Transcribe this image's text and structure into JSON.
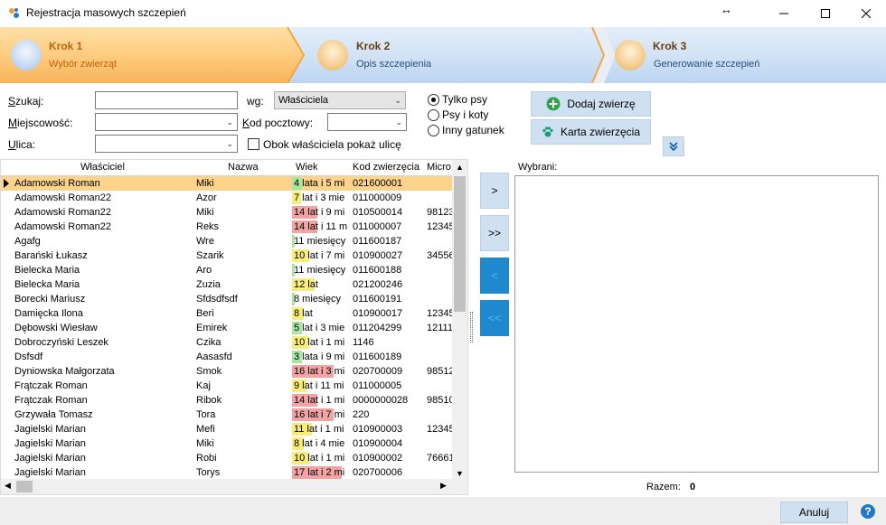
{
  "window": {
    "title": "Rejestracja masowych szczepień",
    "resize_glyph": "↔"
  },
  "wizard": {
    "steps": [
      {
        "title": "Krok 1",
        "subtitle": "Wybór zwierząt"
      },
      {
        "title": "Krok 2",
        "subtitle": "Opis szczepienia"
      },
      {
        "title": "Krok 3",
        "subtitle": "Generowanie szczepień"
      }
    ]
  },
  "filters": {
    "search_label": "Szukaj:",
    "search_value": "",
    "by_label": "wg:",
    "by_value": "Właściciela",
    "city_label": "Miejscowość:",
    "postal_label": "Kod pocztowy:",
    "street_label": "Ulica:",
    "show_street_label": "Obok właściciela pokaż ulicę",
    "species_options": [
      {
        "label": "Tylko psy",
        "checked": true
      },
      {
        "label": "Psy i koty",
        "checked": false
      },
      {
        "label": "Inny gatunek",
        "checked": false
      }
    ],
    "add_animal_label": "Dodaj zwierzę",
    "animal_card_label": "Karta zwierzęcia"
  },
  "grid": {
    "columns": [
      "Właściciel",
      "Nazwa",
      "Wiek",
      "Kod zwierzęcia",
      "Micro"
    ],
    "rows": [
      {
        "owner": "Adamowski Roman",
        "name": "Miki",
        "age": "4 lata i 5 mi",
        "age_years": 4,
        "code": "021600001",
        "micro": ""
      },
      {
        "owner": "Adamowski Roman22",
        "name": "Azor",
        "age": "7 lat i 3 mie",
        "age_years": 7,
        "code": "011000009",
        "micro": ""
      },
      {
        "owner": "Adamowski Roman22",
        "name": "Miki",
        "age": "14 lat i 9 mi",
        "age_years": 14,
        "code": "010500014",
        "micro": "98123"
      },
      {
        "owner": "Adamowski Roman22",
        "name": "Reks",
        "age": "14 lat i 11 m",
        "age_years": 14,
        "code": "011000007",
        "micro": "12345"
      },
      {
        "owner": "Agafg",
        "name": "Wre",
        "age": "11 miesięcy",
        "age_years": 0,
        "code": "011600187",
        "micro": ""
      },
      {
        "owner": "Barański Łukasz",
        "name": "Szarik",
        "age": "10 lat i 7 mi",
        "age_years": 10,
        "code": "010900027",
        "micro": "34556"
      },
      {
        "owner": "Bielecka Maria",
        "name": "Aro",
        "age": "11 miesięcy",
        "age_years": 0,
        "code": "011600188",
        "micro": ""
      },
      {
        "owner": "Bielecka Maria",
        "name": "Zuzia",
        "age": "12 lat",
        "age_years": 12,
        "code": "021200246",
        "micro": ""
      },
      {
        "owner": "Borecki  Mariusz",
        "name": "Sfdsdfsdf",
        "age": "8 miesięcy",
        "age_years": 0,
        "code": "011600191",
        "micro": ""
      },
      {
        "owner": "Damięcka Ilona",
        "name": "Beri",
        "age": "8 lat",
        "age_years": 8,
        "code": "010900017",
        "micro": "12345"
      },
      {
        "owner": "Dębowski Wiesław",
        "name": "Emirek",
        "age": "5 lat i 3 mie",
        "age_years": 5,
        "code": "011204299",
        "micro": "12111"
      },
      {
        "owner": "Dobroczyński Leszek",
        "name": "Czika",
        "age": "10 lat i 1 mi",
        "age_years": 10,
        "code": "1146",
        "micro": ""
      },
      {
        "owner": "Dsfsdf",
        "name": "Aasasfd",
        "age": "3 lata i 9 mi",
        "age_years": 3,
        "code": "011600189",
        "micro": ""
      },
      {
        "owner": "Dyniowska Małgorzata",
        "name": "Smok",
        "age": "16 lat i 3 mi",
        "age_years": 16,
        "code": "020700009",
        "micro": "98512"
      },
      {
        "owner": "Frątczak Roman",
        "name": "Kaj",
        "age": "9 lat i 11 mi",
        "age_years": 9,
        "code": "011000005",
        "micro": ""
      },
      {
        "owner": "Frątczak Roman",
        "name": "Ribok",
        "age": "14 lat i 1 mi",
        "age_years": 14,
        "code": "0000000028",
        "micro": "98510"
      },
      {
        "owner": "Grzywała Tomasz",
        "name": "Tora",
        "age": "16 lat i 7 mi",
        "age_years": 16,
        "code": "220",
        "micro": ""
      },
      {
        "owner": "Jagielski Marian",
        "name": "Mefi",
        "age": "11 lat i 1 mi",
        "age_years": 11,
        "code": "010900003",
        "micro": "12345"
      },
      {
        "owner": "Jagielski Marian",
        "name": "Miki",
        "age": "8 lat i 4 mie",
        "age_years": 8,
        "code": "010900004",
        "micro": ""
      },
      {
        "owner": "Jagielski Marian",
        "name": "Robi",
        "age": "10 lat i 1 mi",
        "age_years": 10,
        "code": "010900002",
        "micro": "76661"
      },
      {
        "owner": "Jagielski Marian",
        "name": "Torys",
        "age": "17 lat i 2 mi",
        "age_years": 17,
        "code": "020700006",
        "micro": ""
      }
    ]
  },
  "transfer_buttons": [
    ">",
    ">>",
    "<",
    "<<"
  ],
  "selected_panel": {
    "label": "Wybrani:",
    "total_label": "Razem:",
    "total_value": "0"
  },
  "footer": {
    "cancel_label": "Anuluj",
    "help_glyph": "?"
  },
  "colors": {
    "accent": "#1f89cf",
    "age_young": "#a9e6a0",
    "age_mid": "#f8ec7a",
    "age_old": "#f2a4a4",
    "selected_row": "#fbd38a",
    "step_active": "#ffca7c",
    "step_inactive": "#c8dcf3"
  }
}
